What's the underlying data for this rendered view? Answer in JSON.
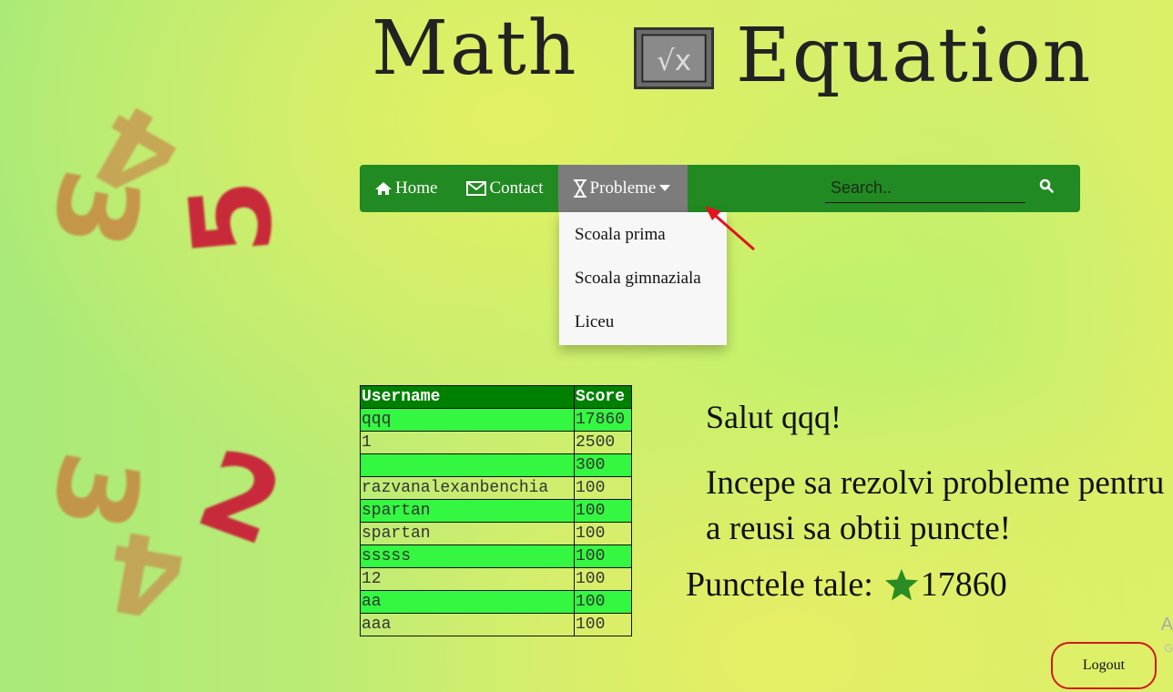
{
  "header": {
    "logo_left": "Math",
    "logo_right": "Equation",
    "logo_box_symbol": "√x"
  },
  "nav": {
    "items": [
      {
        "label": "Home",
        "icon": "home-icon"
      },
      {
        "label": "Contact",
        "icon": "envelope-icon"
      },
      {
        "label": "Probleme",
        "icon": "hourglass-icon",
        "active": true
      }
    ],
    "search": {
      "placeholder": "Search.."
    },
    "color": "#218a22",
    "active_color": "#7c7c7c"
  },
  "dropdown": {
    "items": [
      "Scoala prima",
      "Scoala gimnaziala",
      "Liceu"
    ]
  },
  "leaderboard": {
    "headers": [
      "Username",
      "Score"
    ],
    "rows": [
      {
        "user": "qqq",
        "score": "17860"
      },
      {
        "user": "1",
        "score": "2500"
      },
      {
        "user": "",
        "score": "300"
      },
      {
        "user": "razvanalexanbenchia",
        "score": "100"
      },
      {
        "user": "spartan",
        "score": "100"
      },
      {
        "user": "spartan",
        "score": "100"
      },
      {
        "user": "sssss",
        "score": "100"
      },
      {
        "user": "12",
        "score": "100"
      },
      {
        "user": "aa",
        "score": "100"
      },
      {
        "user": "aaa",
        "score": "100"
      }
    ],
    "header_color": "#008000",
    "alt_row_color": "#33f740"
  },
  "main": {
    "greeting": "Salut qqq!",
    "message": "Incepe sa rezolvi probleme pentru a reusi sa obtii puncte!",
    "points_label": "Punctele tale:",
    "points_value": "17860"
  },
  "logout": {
    "label": "Logout"
  },
  "edge": {
    "char1": "A",
    "char2": "G"
  },
  "decorations": {
    "digits_top": [
      "3",
      "4",
      "5"
    ],
    "digits_bottom": [
      "3",
      "4",
      "2"
    ]
  }
}
